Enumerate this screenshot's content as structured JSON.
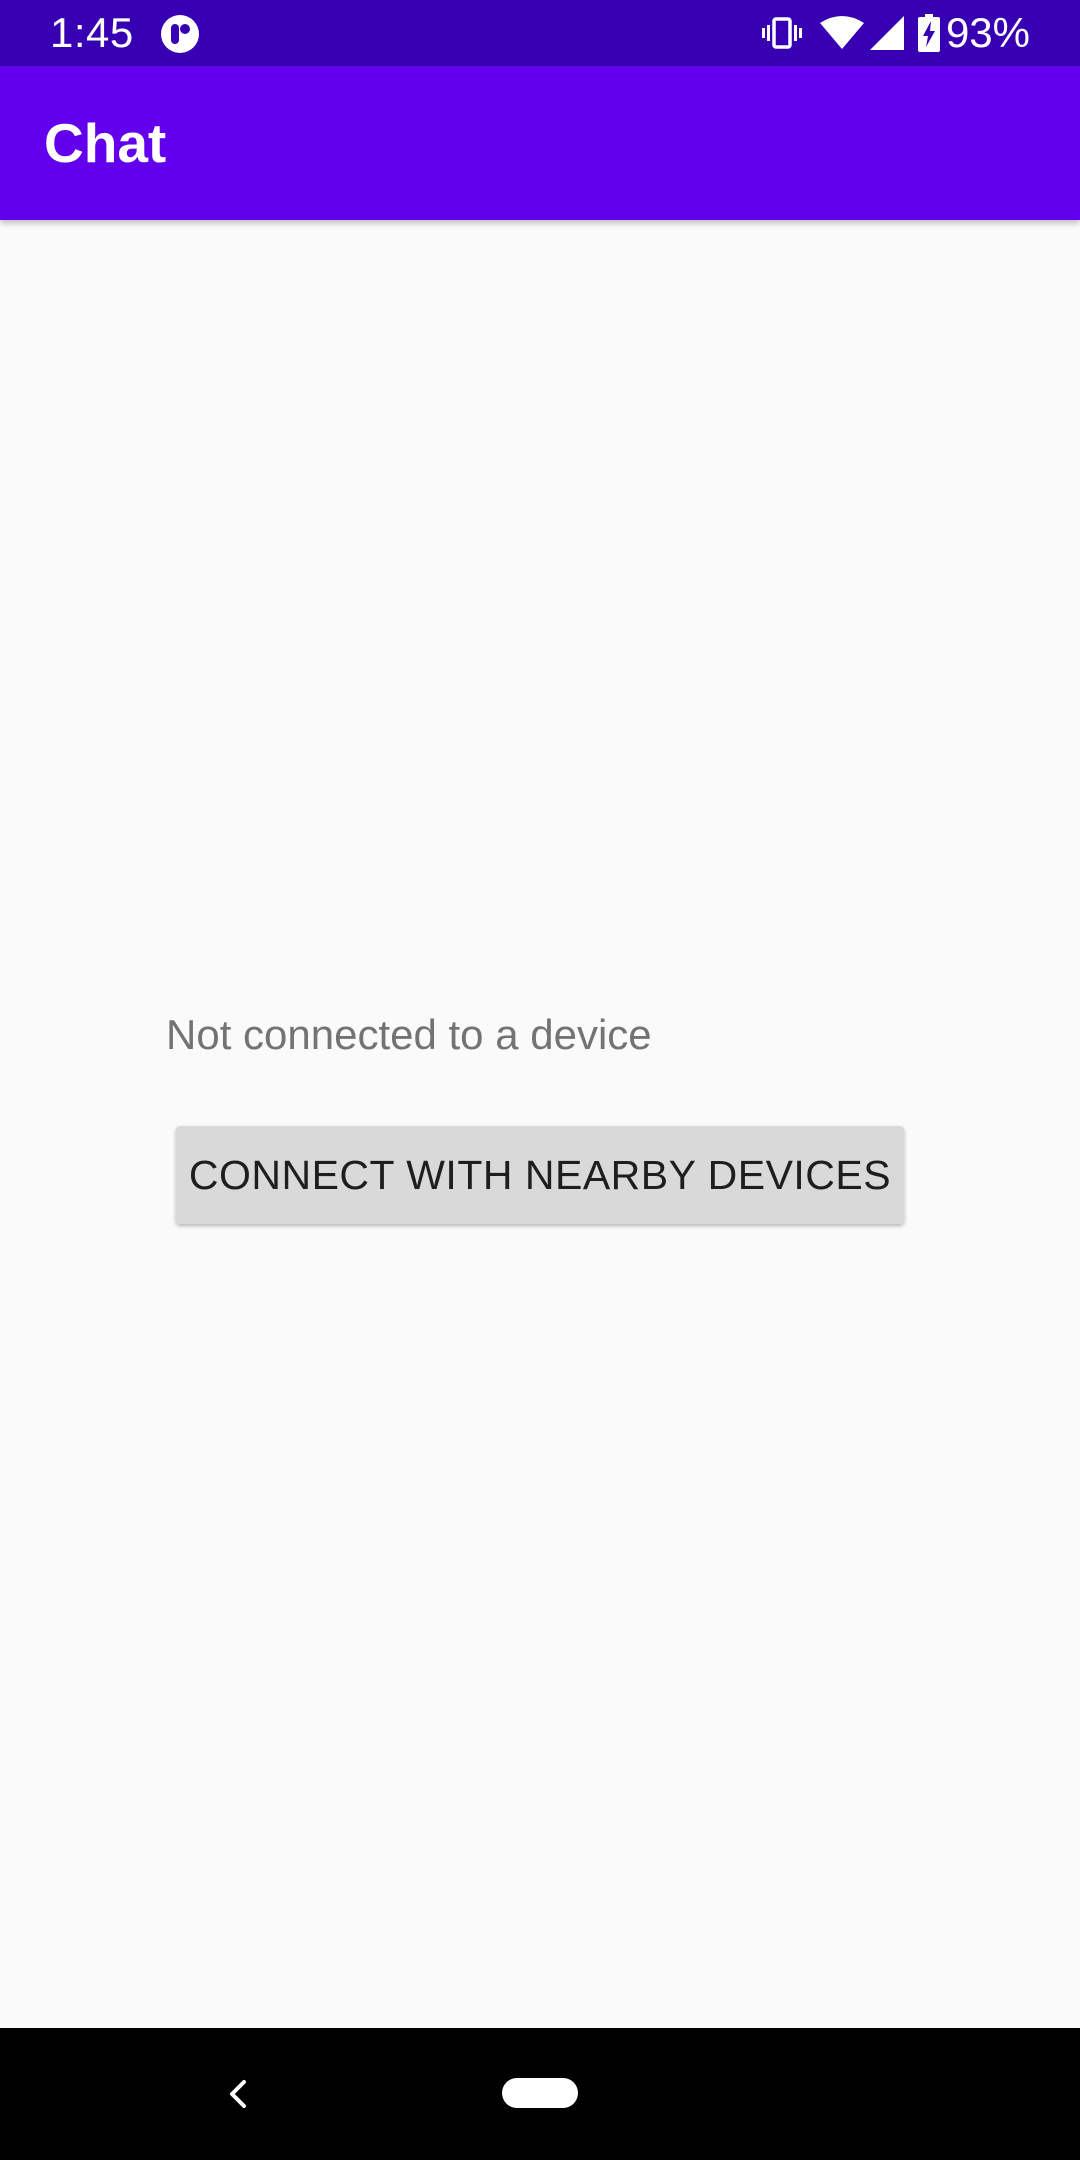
{
  "status_bar": {
    "time": "1:45",
    "battery_percent": "93%",
    "icons": [
      "app-notification-icon",
      "vibrate-icon",
      "wifi-icon",
      "cell-signal-icon",
      "battery-charging-icon"
    ]
  },
  "app_bar": {
    "title": "Chat"
  },
  "main": {
    "status_text": "Not connected to a device",
    "connect_button_label": "CONNECT WITH NEARBY DEVICES"
  },
  "nav_bar": {
    "icons": [
      "back-icon",
      "home-pill-icon"
    ]
  },
  "colors": {
    "status_bar": "#3700b3",
    "app_bar": "#6200ee",
    "background": "#fafafa",
    "button": "#d8d9d8"
  }
}
